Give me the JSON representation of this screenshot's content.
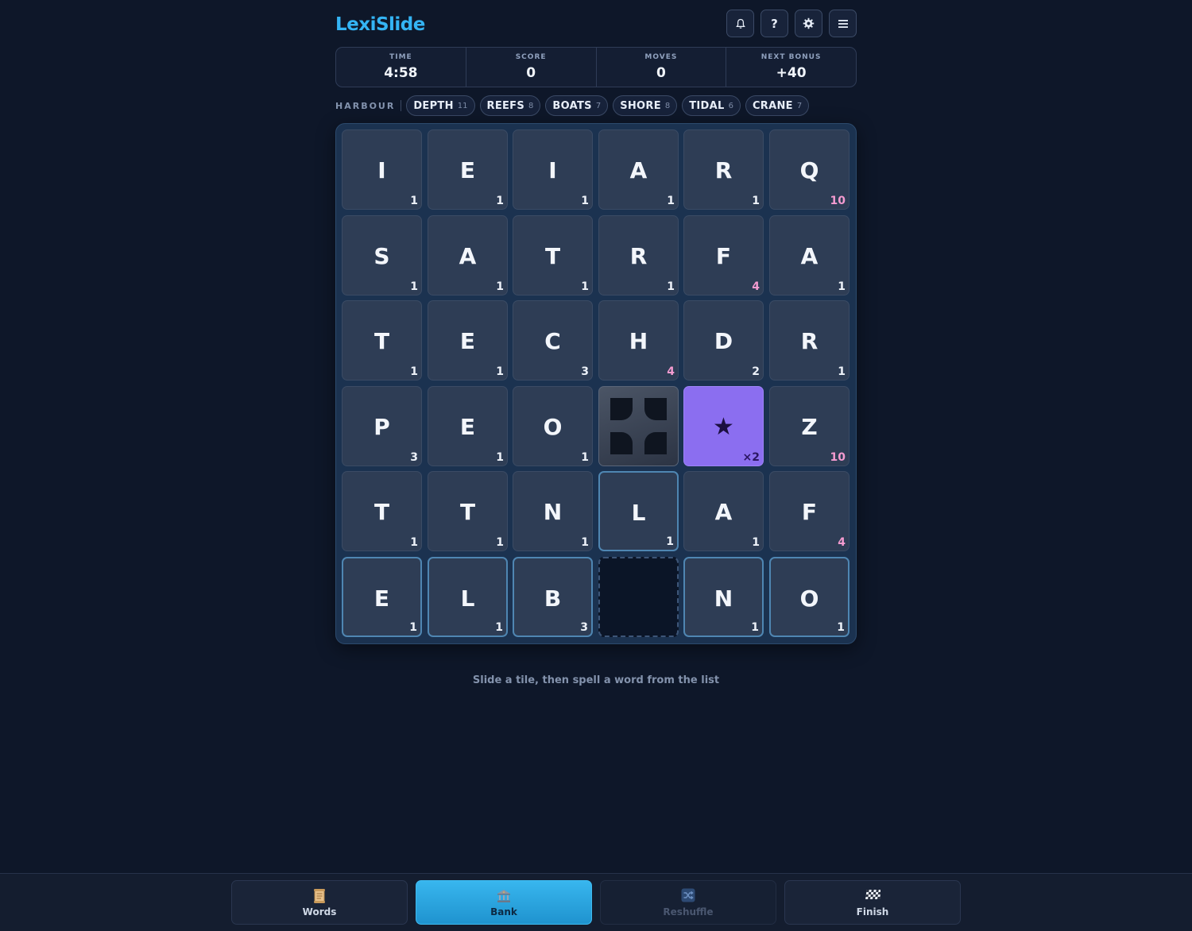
{
  "app": {
    "title": "LexiSlide"
  },
  "header": {
    "buttons": [
      {
        "icon": "bell-icon"
      },
      {
        "icon": "help-icon",
        "glyph": "?"
      },
      {
        "icon": "gear-icon"
      },
      {
        "icon": "menu-icon"
      }
    ]
  },
  "stats": {
    "time": {
      "label": "TIME",
      "value": "4:58"
    },
    "score": {
      "label": "SCORE",
      "value": "0"
    },
    "moves": {
      "label": "MOVES",
      "value": "0"
    },
    "bonus": {
      "label": "NEXT BONUS",
      "value": "+40"
    }
  },
  "wordlist": {
    "title": "HARBOUR",
    "words": [
      {
        "word": "DEPTH",
        "count": "11"
      },
      {
        "word": "REEFS",
        "count": "8"
      },
      {
        "word": "BOATS",
        "count": "7"
      },
      {
        "word": "SHORE",
        "count": "8"
      },
      {
        "word": "TIDAL",
        "count": "6"
      },
      {
        "word": "CRANE",
        "count": "7"
      }
    ]
  },
  "board": {
    "rows": [
      [
        {
          "letter": "I",
          "points": "1"
        },
        {
          "letter": "E",
          "points": "1"
        },
        {
          "letter": "I",
          "points": "1"
        },
        {
          "letter": "A",
          "points": "1"
        },
        {
          "letter": "R",
          "points": "1"
        },
        {
          "letter": "Q",
          "points": "10",
          "high": true
        }
      ],
      [
        {
          "letter": "S",
          "points": "1"
        },
        {
          "letter": "A",
          "points": "1"
        },
        {
          "letter": "T",
          "points": "1"
        },
        {
          "letter": "R",
          "points": "1"
        },
        {
          "letter": "F",
          "points": "4",
          "high": true
        },
        {
          "letter": "A",
          "points": "1"
        }
      ],
      [
        {
          "letter": "T",
          "points": "1"
        },
        {
          "letter": "E",
          "points": "1"
        },
        {
          "letter": "C",
          "points": "3"
        },
        {
          "letter": "H",
          "points": "4",
          "high": true
        },
        {
          "letter": "D",
          "points": "2"
        },
        {
          "letter": "R",
          "points": "1"
        }
      ],
      [
        {
          "letter": "P",
          "points": "3"
        },
        {
          "letter": "E",
          "points": "1"
        },
        {
          "letter": "O",
          "points": "1"
        },
        {
          "type": "blocker"
        },
        {
          "type": "star",
          "letter": "★",
          "points": "×2"
        },
        {
          "letter": "Z",
          "points": "10",
          "high": true
        }
      ],
      [
        {
          "letter": "T",
          "points": "1"
        },
        {
          "letter": "T",
          "points": "1"
        },
        {
          "letter": "N",
          "points": "1"
        },
        {
          "letter": "L",
          "points": "1",
          "outlined": true
        },
        {
          "letter": "A",
          "points": "1"
        },
        {
          "letter": "F",
          "points": "4",
          "high": true
        }
      ],
      [
        {
          "letter": "E",
          "points": "1",
          "outlined": true
        },
        {
          "letter": "L",
          "points": "1",
          "outlined": true
        },
        {
          "letter": "B",
          "points": "3",
          "outlined": true
        },
        {
          "type": "empty"
        },
        {
          "letter": "N",
          "points": "1",
          "outlined": true
        },
        {
          "letter": "O",
          "points": "1",
          "outlined": true
        }
      ]
    ]
  },
  "hint": "Slide a tile, then spell a word from the list",
  "bottom_nav": [
    {
      "label": "Words",
      "icon": "scroll-icon",
      "state": "normal"
    },
    {
      "label": "Bank",
      "icon": "bank-icon",
      "state": "active"
    },
    {
      "label": "Reshuffle",
      "icon": "shuffle-icon",
      "state": "disabled"
    },
    {
      "label": "Finish",
      "icon": "checkered-flag-icon",
      "state": "normal"
    }
  ],
  "colors": {
    "background": "#0e1729",
    "accent": "#34b4f4",
    "tile": "#2e3d55",
    "high_points": "#f49bd0",
    "star_tile": "#8b6ef0"
  }
}
